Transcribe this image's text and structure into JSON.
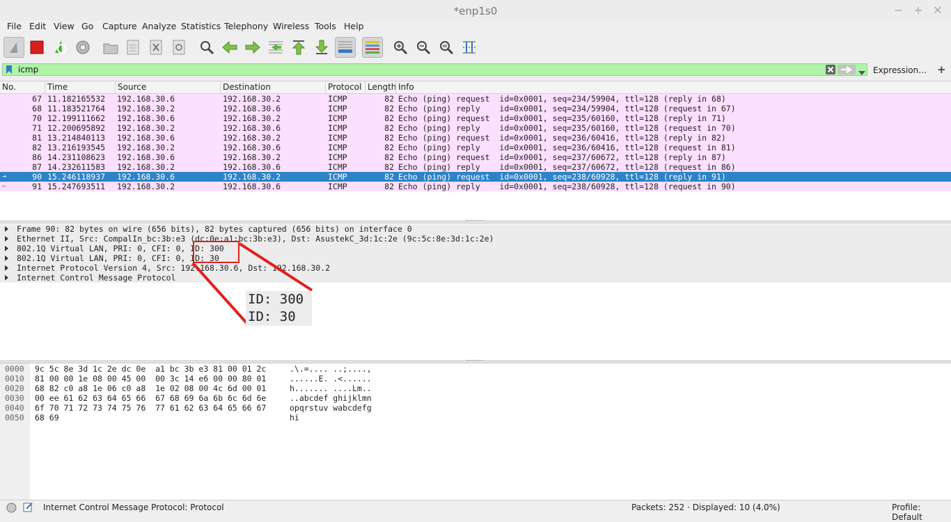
{
  "window": {
    "title": "*enp1s0",
    "controls": [
      "−",
      "+",
      "✕"
    ]
  },
  "menu": [
    "File",
    "Edit",
    "View",
    "Go",
    "Capture",
    "Analyze",
    "Statistics",
    "Telephony",
    "Wireless",
    "Tools",
    "Help"
  ],
  "toolbar": {
    "icons": [
      "shark-fin-icon",
      "stop-capture-icon",
      "restart-capture-icon",
      "capture-options-icon",
      "open-file-icon",
      "save-file-icon",
      "close-file-icon",
      "reload-file-icon",
      "find-packet-icon",
      "go-back-icon",
      "go-forward-icon",
      "go-to-packet-icon",
      "first-packet-icon",
      "last-packet-icon",
      "autoscroll-icon",
      "colorize-icon",
      "zoom-in-icon",
      "zoom-out-icon",
      "normal-size-icon",
      "resize-columns-icon"
    ]
  },
  "filter": {
    "value": "icmp",
    "expression_label": "Expression…",
    "add_label": "+"
  },
  "packet_list": {
    "columns": [
      "No.",
      "Time",
      "Source",
      "Destination",
      "Protocol",
      "Length",
      "Info"
    ],
    "rows": [
      {
        "no": "67",
        "time": "11.182165532",
        "src": "192.168.30.6",
        "dst": "192.168.30.2",
        "proto": "ICMP",
        "len": "82",
        "info": "Echo (ping) request  id=0x0001, seq=234/59904, ttl=128 (reply in 68)",
        "rel": ""
      },
      {
        "no": "68",
        "time": "11.183521764",
        "src": "192.168.30.2",
        "dst": "192.168.30.6",
        "proto": "ICMP",
        "len": "82",
        "info": "Echo (ping) reply    id=0x0001, seq=234/59904, ttl=128 (request in 67)",
        "rel": ""
      },
      {
        "no": "70",
        "time": "12.199111662",
        "src": "192.168.30.6",
        "dst": "192.168.30.2",
        "proto": "ICMP",
        "len": "82",
        "info": "Echo (ping) request  id=0x0001, seq=235/60160, ttl=128 (reply in 71)",
        "rel": ""
      },
      {
        "no": "71",
        "time": "12.200695892",
        "src": "192.168.30.2",
        "dst": "192.168.30.6",
        "proto": "ICMP",
        "len": "82",
        "info": "Echo (ping) reply    id=0x0001, seq=235/60160, ttl=128 (request in 70)",
        "rel": ""
      },
      {
        "no": "81",
        "time": "13.214840113",
        "src": "192.168.30.6",
        "dst": "192.168.30.2",
        "proto": "ICMP",
        "len": "82",
        "info": "Echo (ping) request  id=0x0001, seq=236/60416, ttl=128 (reply in 82)",
        "rel": ""
      },
      {
        "no": "82",
        "time": "13.216193545",
        "src": "192.168.30.2",
        "dst": "192.168.30.6",
        "proto": "ICMP",
        "len": "82",
        "info": "Echo (ping) reply    id=0x0001, seq=236/60416, ttl=128 (request in 81)",
        "rel": ""
      },
      {
        "no": "86",
        "time": "14.231108623",
        "src": "192.168.30.6",
        "dst": "192.168.30.2",
        "proto": "ICMP",
        "len": "82",
        "info": "Echo (ping) request  id=0x0001, seq=237/60672, ttl=128 (reply in 87)",
        "rel": ""
      },
      {
        "no": "87",
        "time": "14.232611583",
        "src": "192.168.30.2",
        "dst": "192.168.30.6",
        "proto": "ICMP",
        "len": "82",
        "info": "Echo (ping) reply    id=0x0001, seq=237/60672, ttl=128 (request in 86)",
        "rel": ""
      },
      {
        "no": "90",
        "time": "15.246118937",
        "src": "192.168.30.6",
        "dst": "192.168.30.2",
        "proto": "ICMP",
        "len": "82",
        "info": "Echo (ping) request  id=0x0001, seq=238/60928, ttl=128 (reply in 91)",
        "rel": "→",
        "selected": true
      },
      {
        "no": "91",
        "time": "15.247693511",
        "src": "192.168.30.2",
        "dst": "192.168.30.6",
        "proto": "ICMP",
        "len": "82",
        "info": "Echo (ping) reply    id=0x0001, seq=238/60928, ttl=128 (request in 90)",
        "rel": "←"
      }
    ]
  },
  "details": [
    "Frame 90: 82 bytes on wire (656 bits), 82 bytes captured (656 bits) on interface 0",
    "Ethernet II, Src: CompalIn_bc:3b:e3 (dc:0e:a1:bc:3b:e3), Dst: AsustekC_3d:1c:2e (9c:5c:8e:3d:1c:2e)",
    "802.1Q Virtual LAN, PRI: 0, CFI: 0, ID: 300",
    "802.1Q Virtual LAN, PRI: 0, CFI: 0, ID: 30",
    "Internet Protocol Version 4, Src: 192.168.30.6, Dst: 192.168.30.2",
    "Internet Control Message Protocol"
  ],
  "annotation": {
    "line1": "ID: 300",
    "line2": "ID: 30",
    "color": "#e02020"
  },
  "bytes": [
    {
      "off": "0000",
      "hex": "9c 5c 8e 3d 1c 2e dc 0e  a1 bc 3b e3 81 00 01 2c",
      "ascii": ".\\.=.... ..;....,"
    },
    {
      "off": "0010",
      "hex": "81 00 00 1e 08 00 45 00  00 3c 14 e6 00 00 80 01",
      "ascii": "......E. .<......"
    },
    {
      "off": "0020",
      "hex": "68 82 c0 a8 1e 06 c0 a8  1e 02 08 00 4c 6d 00 01",
      "ascii": "h....... ....Lm.."
    },
    {
      "off": "0030",
      "hex": "00 ee 61 62 63 64 65 66  67 68 69 6a 6b 6c 6d 6e",
      "ascii": "..abcdef ghijklmn"
    },
    {
      "off": "0040",
      "hex": "6f 70 71 72 73 74 75 76  77 61 62 63 64 65 66 67",
      "ascii": "opqrstuv wabcdefg"
    },
    {
      "off": "0050",
      "hex": "68 69",
      "ascii": "hi"
    }
  ],
  "status": {
    "field": "Internet Control Message Protocol: Protocol",
    "packets": "Packets: 252 · Displayed: 10 (4.0%)",
    "profile": "Profile: Default"
  },
  "colors": {
    "row_bg": "#fce0ff",
    "selected_bg": "#2c83c7",
    "filter_bg": "#aff5a8"
  }
}
